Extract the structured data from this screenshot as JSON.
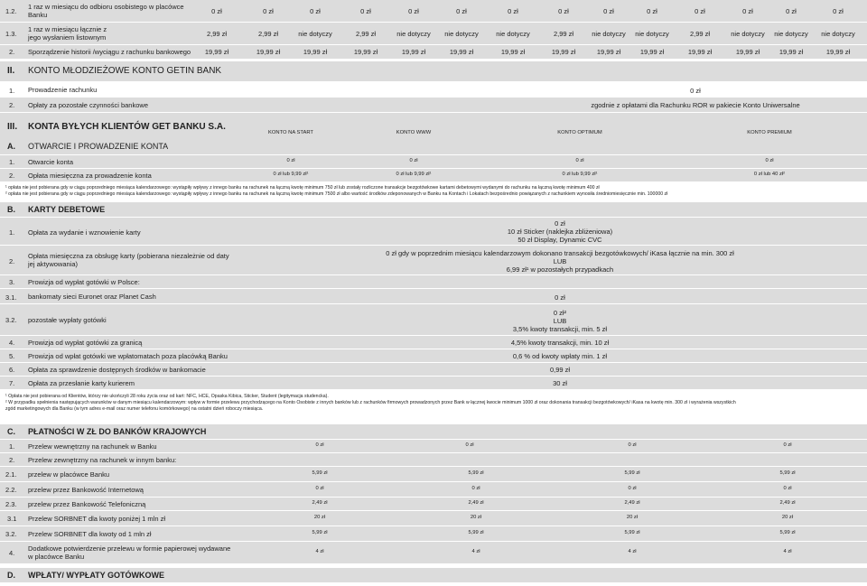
{
  "r12": {
    "num": "1.2.",
    "label": "1 raz w miesiącu do odbioru osobistego w placówce Banku",
    "vals": [
      "0 zł",
      "0 zł",
      "0 zł",
      "0 zł",
      "0 zł",
      "0 zł",
      "0 zł",
      "0 zł",
      "0 zł",
      "0 zł",
      "0 zł",
      "0 zł",
      "0 zł",
      "0 zł"
    ]
  },
  "r13": {
    "num": "1.3.",
    "label": "1 raz w miesiącu łącznie z jego wysłaniem listownym",
    "vals": [
      "2,99 zł",
      "2,99 zł",
      "nie dotyczy",
      "2,99 zł",
      "nie dotyczy",
      "nie dotyczy",
      "nie dotyczy",
      "2,99 zł",
      "nie dotyczy",
      "nie dotyczy",
      "2,99 zł",
      "nie dotyczy",
      "nie dotyczy",
      "nie dotyczy"
    ]
  },
  "r2": {
    "num": "2.",
    "label": "Sporządzenie historii /wyciągu z rachunku bankowego",
    "vals": [
      "19,99 zł",
      "19,99 zł",
      "19,99 zł",
      "19,99 zł",
      "19,99 zł",
      "19,99 zł",
      "19,99 zł",
      "19,99 zł",
      "19,99 zł",
      "19,99 zł",
      "19,99 zł",
      "19,99 zł",
      "19,99 zł",
      "19,99 zł"
    ]
  },
  "s2": {
    "num": "II.",
    "title": "KONTO MŁODZIEŻOWE KONTO GETIN BANK"
  },
  "s2r1": {
    "num": "1.",
    "label": "Prowadzenie rachunku",
    "val": "0 zł"
  },
  "s2r2": {
    "num": "2.",
    "label": "Opłaty za pozostałe czynności bankowe",
    "val": "zgodnie z opłatami dla Rachunku ROR w pakiecie Konto Uniwersalne"
  },
  "s3": {
    "num": "III.",
    "title": "KONTA BYŁYCH KLIENTÓW GET BANKU S.A.",
    "cols": [
      "KONTO NA START",
      "KONTO WWW",
      "KONTO OPTIMUM",
      "KONTO PREMIUM"
    ]
  },
  "sA": {
    "num": "A.",
    "title": "OTWARCIE I PROWADZENIE KONTA"
  },
  "a1": {
    "num": "1.",
    "label": "Otwarcie konta",
    "vals": [
      "0 zł",
      "0 zł",
      "0 zł",
      "0 zł"
    ]
  },
  "a2": {
    "num": "2.",
    "label": "Opłata miesięczna za prowadzenie konta",
    "vals": [
      "0 zł lub 9,99 zł¹",
      "0 zł lub 9,99 zł¹",
      "0 zł lub 9,99 zł¹",
      "0 zł lub 40 zł²"
    ]
  },
  "notesA": [
    "¹ opłata nie jest pobierana gdy w ciągu poprzedniego miesiąca kalendarzowego: wystąpiły wpływy z innego banku na rachunek na łączną kwotę minimum 750 zł lub zostały rozliczone transakcje bezgotówkowe kartami debetowymi wydanymi do rachunku na łączną kwotę minimum 400 zł",
    "² opłata nie jest pobierana gdy w ciągu poprzedniego miesiąca kalendarzowego: wystąpiły wpływy z innego banku na rachunek na łączną kwotę minimum 7500 zł albo wartość środków zdeponowanych w Banku na Kontach i Lokatach bezpośrednio powiązanych z rachunkiem wynosiła średniomiesięcznie min. 100000 zł"
  ],
  "sB": {
    "num": "B.",
    "title": "KARTY DEBETOWE"
  },
  "b1": {
    "num": "1.",
    "label": "Opłata za wydanie i wznowienie karty",
    "val": [
      "0 zł",
      "10 zł Sticker (naklejka zbliżeniowa)",
      "50 zł Display, Dynamic CVC"
    ]
  },
  "b2": {
    "num": "2.",
    "label": "Opłata miesięczna za obsługę karty (pobierana niezależnie od daty jej aktywowania)",
    "val": [
      "0 zł gdy w poprzednim miesiącu kalendarzowym dokonano transakcji bezgotówkowych/ iKasa łącznie na min. 300 zł",
      "LUB",
      "6,99  zł¹ w pozostałych przypadkach"
    ]
  },
  "b3": {
    "num": "3.",
    "label": "Prowizja od wypłat gotówki w Polsce:"
  },
  "b31": {
    "num": "3.1.",
    "label": "bankomaty sieci Euronet oraz Planet Cash",
    "val": "0 zł"
  },
  "b32": {
    "num": "3.2.",
    "label": "pozostałe wypłaty gotówki",
    "val": [
      "0 zł²",
      "LUB",
      "3,5% kwoty transakcji, min. 5 zł"
    ]
  },
  "b4": {
    "num": "4.",
    "label": "Prowizja od wypłat gotówki za granicą",
    "val": "4,5% kwoty transakcji, min. 10 zł"
  },
  "b5": {
    "num": "5.",
    "label": "Prowizja od wpłat gotówki we wpłatomatach poza placówką Banku",
    "val": "0,6 % od kwoty wpłaty min. 1 zł"
  },
  "b6": {
    "num": "6.",
    "label": "Opłata za sprawdzenie dostępnych środków w bankomacie",
    "val": "0,99 zł"
  },
  "b7": {
    "num": "7.",
    "label": "Opłata za przesłanie karty kurierem",
    "val": "30 zł"
  },
  "notesB": [
    "¹ Opłata nie jest pobierana od Klientów, którzy nie ukończyli 28 roku życia  oraz od kart: NFC, HCE, Opaska Kibica, Sticker, Student (legitymacja studencka).",
    "² W przypadku spełnienia następujących warunków w danym miesiącu kalendarzowym: wpływ w formie przelewu przychodzącego na Konto Osobiste z innych banków lub z rachunków firmowych prowadzonych przez Bank w łącznej kwocie minimum 1000 zł oraz dokonania transakcji bezgotówkowych/ iKasa na kwotę min. 300 zł i wyrażenia wszystkich",
    "zgód marketingowych dla Banku (w tym adres e-mail oraz numer telefonu komórkowego) na ostatni dzień roboczy miesiąca."
  ],
  "sC": {
    "num": "C.",
    "title": "PŁATNOŚCI  W ZŁ DO BANKÓW KRAJOWYCH"
  },
  "c1": {
    "num": "1.",
    "label": "Przelew wewnętrzny na rachunek w Banku",
    "vals": [
      "0 zł",
      "0 zł",
      "0 zł",
      "0 zł"
    ]
  },
  "c2": {
    "num": "2.",
    "label": "Przelew zewnętrzny na rachunek w innym banku:"
  },
  "c21": {
    "num": "2.1.",
    "label": "przelew w placówce Banku",
    "vals": [
      "5,99 zł",
      "5,99 zł",
      "5,99 zł",
      "5,99 zł"
    ]
  },
  "c22": {
    "num": "2.2.",
    "label": "przelew przez Bankowość Internetową",
    "vals": [
      "0 zł",
      "0 zł",
      "0 zł",
      "0 zł"
    ]
  },
  "c23": {
    "num": "2.3.",
    "label": "przelew przez Bankowość Telefoniczną",
    "vals": [
      "2,49 zł",
      "2,49 zł",
      "2,49 zł",
      "2,49 zł"
    ]
  },
  "c31": {
    "num": "3.1",
    "label": "Przelew SORBNET dla kwoty poniżej 1 mln zł",
    "vals": [
      "20 zł",
      "20 zł",
      "20 zł",
      "20 zł"
    ]
  },
  "c32": {
    "num": "3.2.",
    "label": "Przelew SORBNET dla kwoty od 1 mln zł",
    "vals": [
      "5,99  zł",
      "5,99  zł",
      "5,99  zł",
      "5,99  zł"
    ]
  },
  "c4": {
    "num": "4.",
    "label": "Dodatkowe potwierdzenie przelewu w formie papierowej wydawane w placówce Banku",
    "vals": [
      "4 zł",
      "4 zł",
      "4 zł",
      "4 zł"
    ]
  },
  "sD": {
    "num": "D.",
    "title": "WPŁATY/ WYPŁATY GOTÓWKOWE"
  }
}
